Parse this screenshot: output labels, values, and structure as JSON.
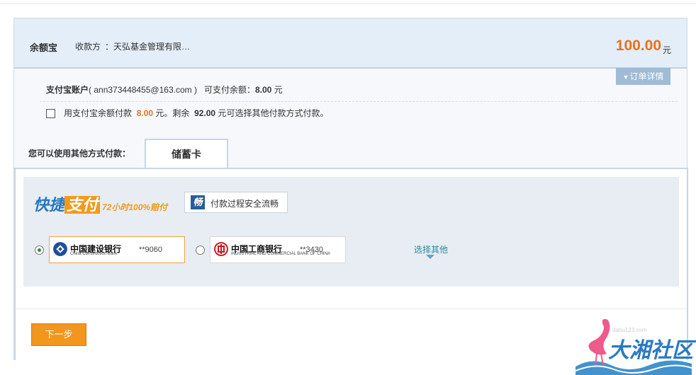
{
  "header": {
    "product": "余额宝",
    "payee_label": "收款方",
    "payee_name": "：天弘基金管理有限…",
    "amount": "100.00",
    "currency": "元",
    "detail_button": "订单详情"
  },
  "account": {
    "label": "支付宝账户",
    "email": "( ann373448455@163.com )",
    "balance_label": "可支付余额：",
    "balance_value": "8.00",
    "balance_unit": "元"
  },
  "balance_option": {
    "prefix": "用支付宝余额付款",
    "amount": "8.00",
    "middle": "元。剩余",
    "remaining": "92.00",
    "suffix": "元可选择其他付款方式付款。"
  },
  "other_methods": {
    "label": "您可以使用其他方式付款：",
    "tab": "储蓄卡"
  },
  "quick_pay": {
    "logo_part1": "快捷",
    "logo_part2": "支付",
    "promise": "72小时100%赔付",
    "badge_icon_char": "畅",
    "badge_text": "付款过程安全流畅"
  },
  "banks": [
    {
      "name": "中国建设银行",
      "sub": "China Construction Bank",
      "number": "**9060",
      "selected": true,
      "color": "#1d4f9c"
    },
    {
      "name": "中国工商银行",
      "sub": "INDUSTRIAL AND COMMERCIAL BANK OF CHINA",
      "number": "**3430",
      "selected": false,
      "color": "#c8161d"
    }
  ],
  "choose_other": "选择其他",
  "next_button": "下一步",
  "watermark": {
    "text": "大湘社区",
    "site": "dahu123.com"
  },
  "colors": {
    "accent_orange": "#e8711c",
    "button_orange": "#f2961e",
    "link_blue": "#2a8a9e",
    "header_bg": "#e4eef8"
  }
}
